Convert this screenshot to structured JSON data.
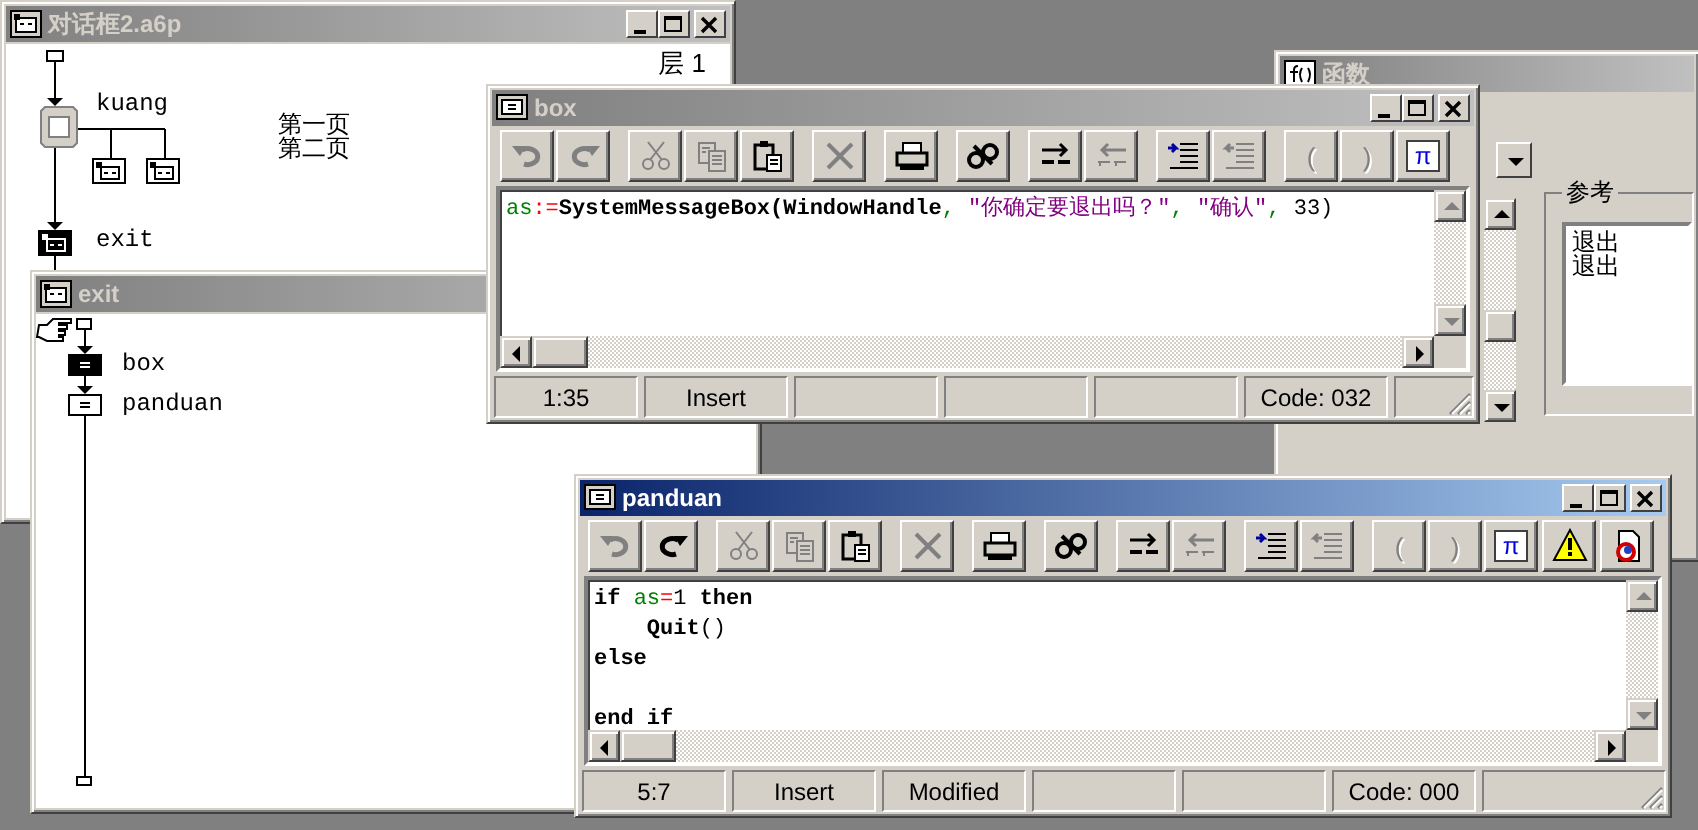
{
  "main_window": {
    "title": "对话框2.a6p",
    "active": false,
    "layer_label": "层 1",
    "nodes": [
      {
        "kind": "framework",
        "label": "kuang",
        "selected": false,
        "children": [
          {
            "kind": "page",
            "selected": false
          },
          {
            "kind": "page",
            "selected": false
          }
        ]
      },
      {
        "kind": "map",
        "label": "exit",
        "selected": true
      }
    ],
    "page_titles": [
      "第一页",
      "第二页"
    ]
  },
  "exit_window": {
    "title": "exit",
    "active": false,
    "nodes": [
      {
        "kind": "calculation",
        "label": "box",
        "selected": true
      },
      {
        "kind": "calculation",
        "label": "panduan",
        "selected": false
      }
    ]
  },
  "functions_window": {
    "title": "函数",
    "active": false,
    "group_title": "参考",
    "list_items": [
      "退出",
      "退出"
    ]
  },
  "box_window": {
    "title": "box",
    "active": false,
    "toolbar": [
      {
        "kind": "undo",
        "disabled": true
      },
      {
        "kind": "redo",
        "disabled": true
      },
      {
        "kind": "cut",
        "disabled": true
      },
      {
        "kind": "copy",
        "disabled": true
      },
      {
        "kind": "paste",
        "disabled": false
      },
      {
        "kind": "delete",
        "disabled": true
      },
      {
        "kind": "print",
        "disabled": false
      },
      {
        "kind": "find",
        "disabled": false
      },
      {
        "kind": "arrows-right",
        "disabled": false
      },
      {
        "kind": "arrows-left",
        "disabled": true
      },
      {
        "kind": "indent",
        "disabled": false
      },
      {
        "kind": "outdent",
        "disabled": true
      },
      {
        "kind": "symbol",
        "label": "(",
        "disabled": true
      },
      {
        "kind": "symbol",
        "label": ")",
        "disabled": true
      },
      {
        "kind": "symbol",
        "label": "π",
        "disabled": false
      }
    ],
    "lines": [
      {
        "kind": "code",
        "tokens": [
          {
            "kind": "var",
            "text": "as"
          },
          {
            "kind": "op",
            "text": ":="
          },
          {
            "kind": "bold",
            "text": "SystemMessageBox(WindowHandle"
          },
          {
            "kind": "var",
            "text": ", "
          },
          {
            "kind": "str",
            "text": "\"你确定要退出吗？\""
          },
          {
            "kind": "var",
            "text": ", "
          },
          {
            "kind": "str",
            "text": "\"确认\""
          },
          {
            "kind": "var",
            "text": ", "
          },
          {
            "kind": "plain",
            "text": "33)"
          }
        ]
      }
    ],
    "status": {
      "position": "1:35",
      "mode": "Insert",
      "code": "Code: 032"
    }
  },
  "panduan_window": {
    "title": "panduan",
    "active": true,
    "toolbar": [
      {
        "kind": "undo",
        "disabled": true
      },
      {
        "kind": "redo",
        "disabled": false
      },
      {
        "kind": "cut",
        "disabled": true
      },
      {
        "kind": "copy",
        "disabled": true
      },
      {
        "kind": "paste",
        "disabled": false
      },
      {
        "kind": "delete",
        "disabled": true
      },
      {
        "kind": "print",
        "disabled": false
      },
      {
        "kind": "find",
        "disabled": false
      },
      {
        "kind": "arrows-right",
        "disabled": false
      },
      {
        "kind": "arrows-left",
        "disabled": true
      },
      {
        "kind": "indent",
        "disabled": false
      },
      {
        "kind": "outdent",
        "disabled": true
      },
      {
        "kind": "symbol",
        "label": "(",
        "disabled": true
      },
      {
        "kind": "symbol",
        "label": ")",
        "disabled": true
      },
      {
        "kind": "symbol",
        "label": "π",
        "disabled": false
      },
      {
        "kind": "warning",
        "disabled": false
      },
      {
        "kind": "document",
        "disabled": false
      }
    ],
    "lines": [
      {
        "kind": "code",
        "tokens": [
          {
            "kind": "bold",
            "text": "if "
          },
          {
            "kind": "var",
            "text": "as"
          },
          {
            "kind": "op",
            "text": "="
          },
          {
            "kind": "plain",
            "text": "1 "
          },
          {
            "kind": "bold",
            "text": "then"
          }
        ]
      },
      {
        "kind": "code",
        "tokens": [
          {
            "kind": "bold",
            "text": "    Quit"
          },
          {
            "kind": "plain",
            "text": "()"
          }
        ]
      },
      {
        "kind": "code",
        "tokens": [
          {
            "kind": "bold",
            "text": "else"
          }
        ]
      },
      {
        "kind": "blank"
      },
      {
        "kind": "code",
        "tokens": [
          {
            "kind": "bold",
            "text": "end if"
          }
        ]
      }
    ],
    "status": {
      "position": "5:7",
      "mode": "Insert",
      "modified": "Modified",
      "code": "Code: 000"
    }
  }
}
